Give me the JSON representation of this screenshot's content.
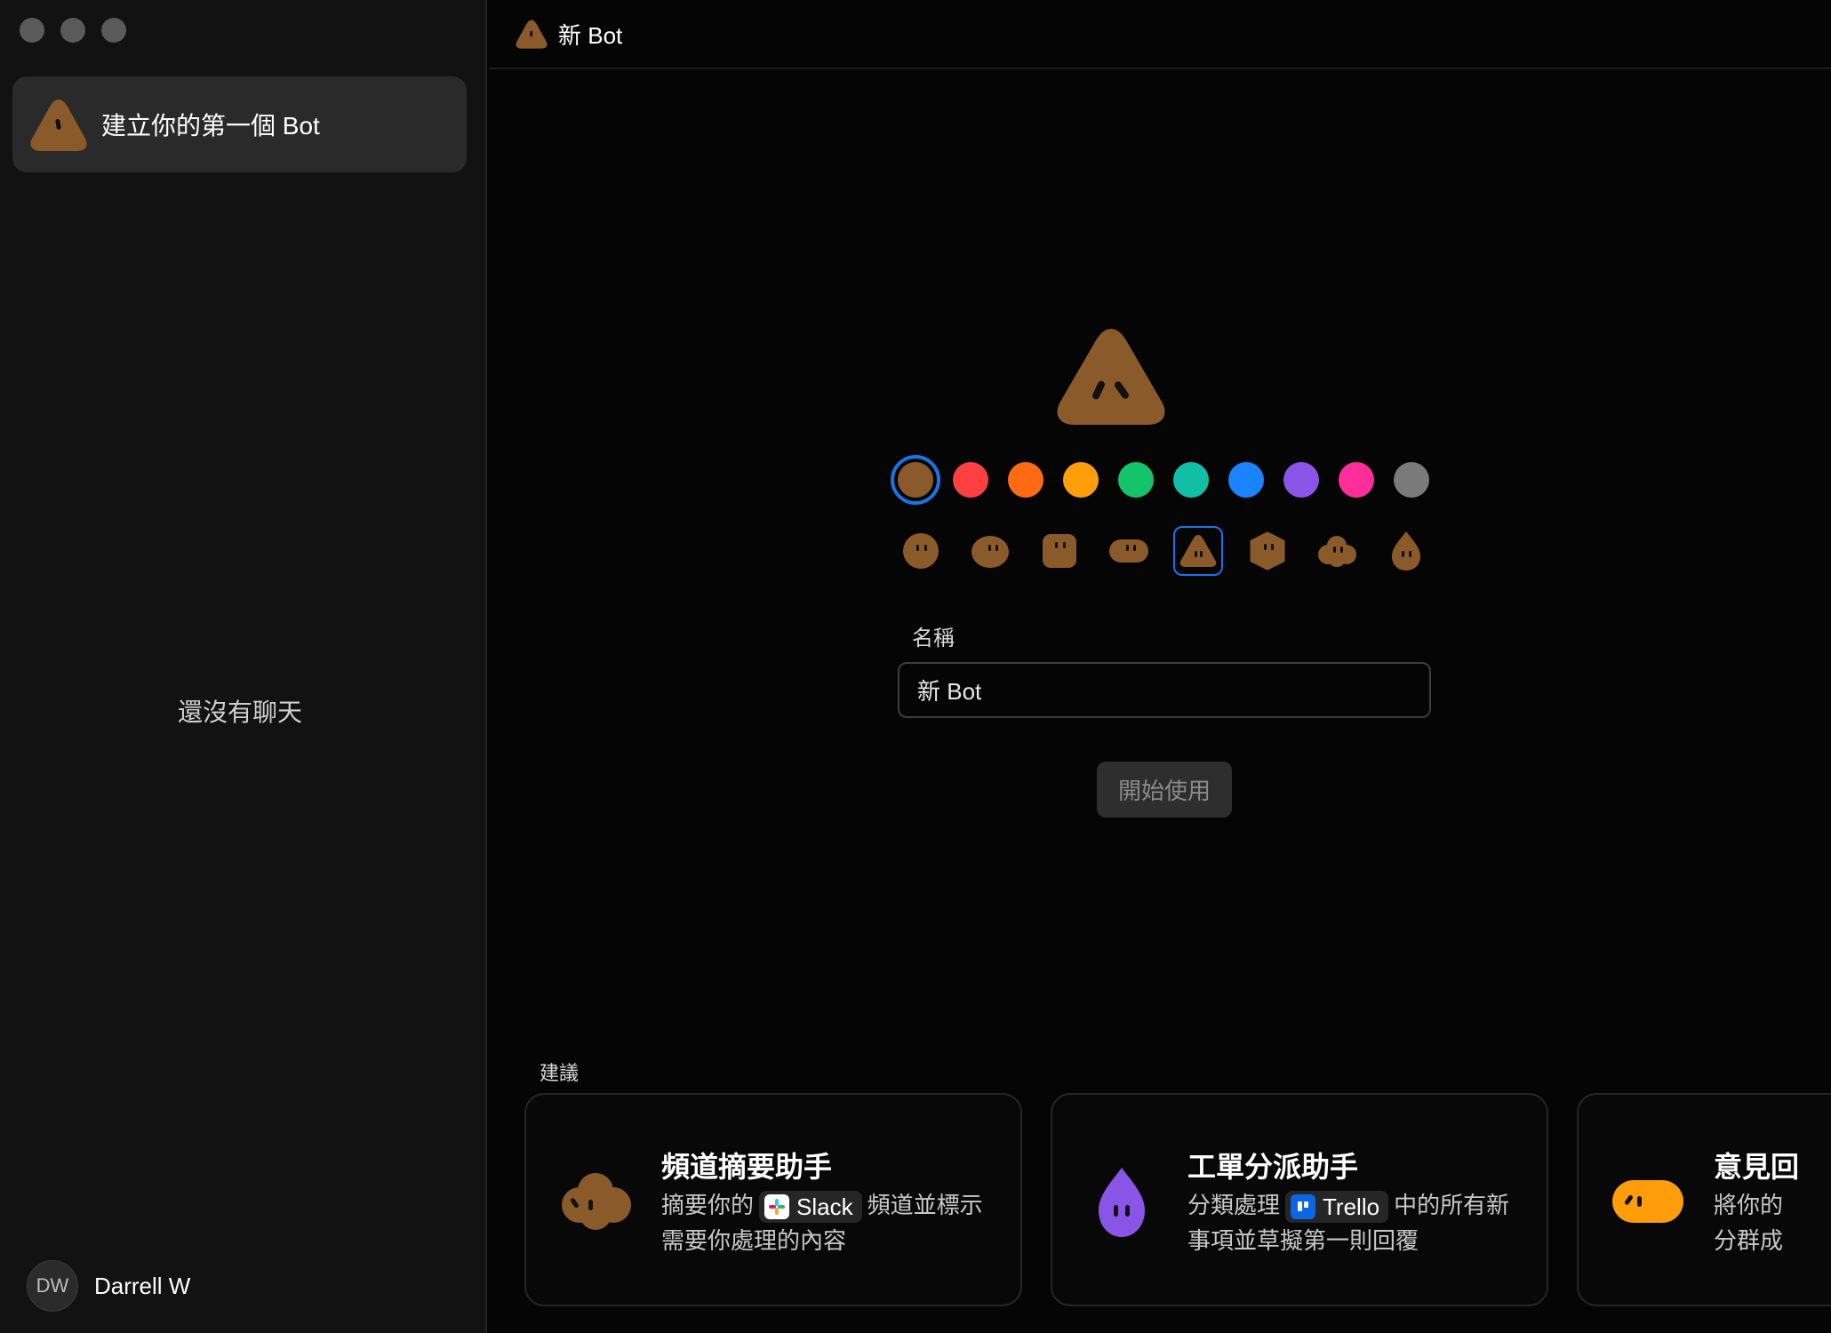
{
  "sidebar": {
    "chat_item_label": "建立你的第一個 Bot",
    "empty_text": "還沒有聊天",
    "user": {
      "initials": "DW",
      "name": "Darrell W"
    }
  },
  "header": {
    "title": "新 Bot"
  },
  "bot_form": {
    "colors": [
      {
        "name": "brown",
        "hex": "#8B5A2B",
        "selected": true
      },
      {
        "name": "red",
        "hex": "#FF4040"
      },
      {
        "name": "orange",
        "hex": "#FF6A13"
      },
      {
        "name": "amber",
        "hex": "#FF9D0A"
      },
      {
        "name": "green",
        "hex": "#14C46A"
      },
      {
        "name": "teal",
        "hex": "#12BFA6"
      },
      {
        "name": "blue",
        "hex": "#1A84FF"
      },
      {
        "name": "purple",
        "hex": "#8A55E6"
      },
      {
        "name": "pink",
        "hex": "#FF2E9A"
      },
      {
        "name": "gray",
        "hex": "#7A7A7A"
      }
    ],
    "shapes": [
      "circle",
      "blob",
      "square",
      "pill",
      "triangle",
      "hexagon",
      "cloud",
      "drop"
    ],
    "selected_shape": "triangle",
    "name_label": "名稱",
    "name_value": "新 Bot",
    "start_button": "開始使用"
  },
  "suggestions": {
    "label": "建議",
    "cards": [
      {
        "title": "頻道摘要助手",
        "desc_before": "摘要你的",
        "pill": "Slack",
        "desc_after": "頻道並標示需要你處理的內容",
        "icon": "brown-cloud-bot-icon",
        "color": "#8B5A2B"
      },
      {
        "title": "工單分派助手",
        "desc_before": "分類處理",
        "pill": "Trello",
        "desc_after": "中的所有新事項並草擬第一則回覆",
        "icon": "purple-drop-bot-icon",
        "color": "#8A55E6"
      },
      {
        "title": "意見回",
        "desc_before": "將你的",
        "pill": "",
        "desc_after": "分群成",
        "icon": "orange-pill-bot-icon",
        "color": "#FF9D0A"
      }
    ]
  }
}
